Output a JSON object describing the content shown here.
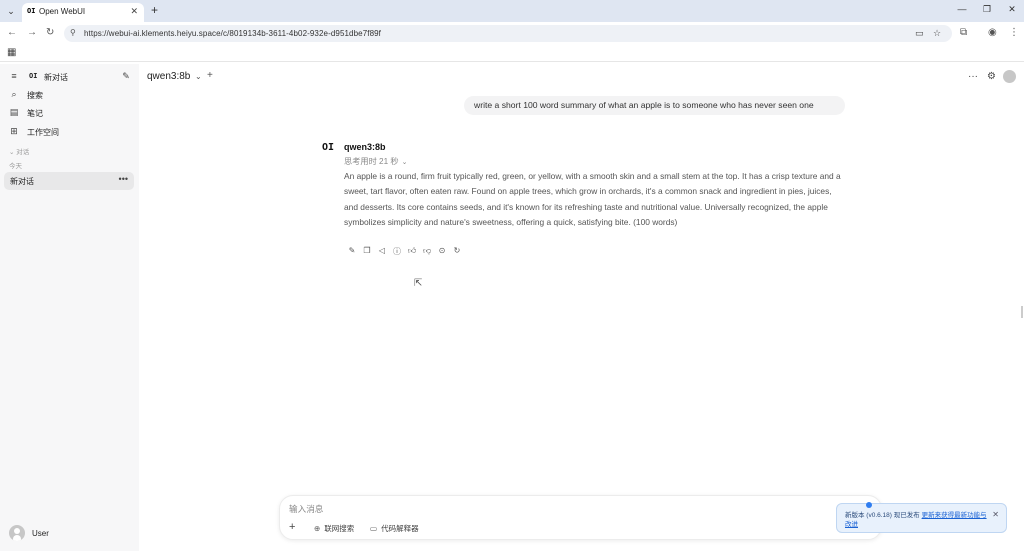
{
  "browser": {
    "tab_title": "Open WebUI",
    "tab_favicon": "OI",
    "url": "https://webui-ai.klements.heiyu.space/c/8019134b-3611-4b02-932e-d951dbe7f89f"
  },
  "sidebar": {
    "logo": "OI",
    "new_chat_label": "新对话",
    "items": [
      {
        "label": "搜索",
        "icon": "search-icon"
      },
      {
        "label": "笔记",
        "icon": "notes-icon"
      },
      {
        "label": "工作空间",
        "icon": "workspace-icon"
      }
    ],
    "section_chats": "对话",
    "section_today": "今天",
    "chats": [
      {
        "label": "新对话"
      }
    ],
    "user_name": "User"
  },
  "header": {
    "model": "qwen3:8b"
  },
  "conversation": {
    "user_message": "write a short 100 word summary of what an apple is to someone who has never seen one",
    "assistant_logo": "OI",
    "assistant_name": "qwen3:8b",
    "thinking_label": "思考用时 21 秒",
    "answer": "An apple is a round, firm fruit typically red, green, or yellow, with a smooth skin and a small stem at the top. It has a crisp texture and a sweet, tart flavor, often eaten raw. Found on apple trees, which grow in orchards, it's a common snack and ingredient in pies, juices, and desserts. Its core contains seeds, and it's known for its refreshing taste and nutritional value. Universally recognized, the apple symbolizes simplicity and nature's sweetness, offering a quick, satisfying bite. (100 words)"
  },
  "composer": {
    "placeholder": "输入消息",
    "web_search_label": "联网搜索",
    "code_interpreter_label": "代码解释器"
  },
  "toast": {
    "prefix": "新版本 (v0.6.18) 现已发布",
    "link": "更新来获得最新功能与改进"
  },
  "colors": {
    "sidebar_bg": "#f7f7f8",
    "toast_bg": "#e8f1fc",
    "accent": "#2f7df0"
  }
}
